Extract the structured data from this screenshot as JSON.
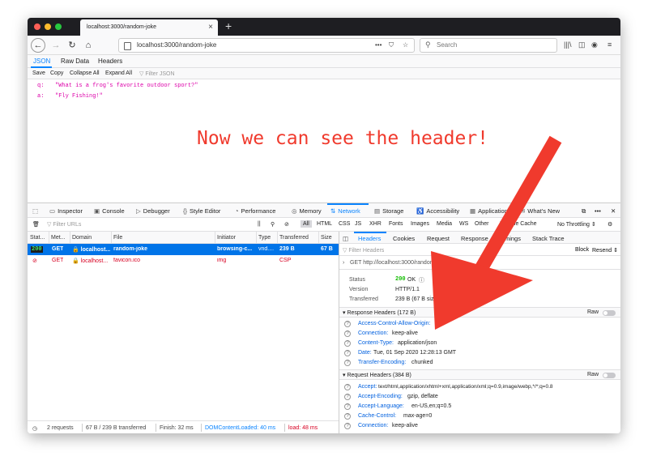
{
  "browser": {
    "tab_title": "localhost:3000/random-joke",
    "url": "localhost:3000/random-joke",
    "url_dots": "•••",
    "search_placeholder": "Search"
  },
  "json_viewer": {
    "tabs": [
      "JSON",
      "Raw Data",
      "Headers"
    ],
    "toolbar": [
      "Save",
      "Copy",
      "Collapse All",
      "Expand All"
    ],
    "filter_placeholder": "Filter JSON",
    "rows": [
      {
        "key": "q:",
        "value": "\"What is a frog's favorite outdoor sport?\""
      },
      {
        "key": "a:",
        "value": "\"Fly Fishing!\""
      }
    ]
  },
  "annotation": "Now we can see the header!",
  "devtools": {
    "tabs": [
      "Inspector",
      "Console",
      "Debugger",
      "Style Editor",
      "Performance",
      "Memory",
      "Network",
      "Storage",
      "Accessibility",
      "Application",
      "What's New"
    ],
    "filter_urls_placeholder": "Filter URLs",
    "type_filters": [
      "All",
      "HTML",
      "CSS",
      "JS",
      "XHR",
      "Fonts",
      "Images",
      "Media",
      "WS",
      "Other"
    ],
    "disable_cache": "Disable Cache",
    "throttling": "No Throttling",
    "columns": [
      "Stat...",
      "Met...",
      "Domain",
      "File",
      "Initiator",
      "Type",
      "Transferred",
      "Size"
    ],
    "requests": [
      {
        "status": "200",
        "method": "GET",
        "domain": "localhost...",
        "file": "random-joke",
        "initiator": "browsing-c...",
        "type": "vnd....",
        "transferred": "239 B",
        "size": "67 B"
      },
      {
        "status": "",
        "method": "GET",
        "domain": "localhost...",
        "file": "favicon.ico",
        "initiator": "img",
        "type": "",
        "transferred": "CSP",
        "size": ""
      }
    ],
    "status_bar": {
      "requests": "2 requests",
      "transferred": "67 B / 239 B transferred",
      "finish": "Finish: 32 ms",
      "dom": "DOMContentLoaded: 40 ms",
      "load": "load: 48 ms"
    },
    "detail_tabs": [
      "Headers",
      "Cookies",
      "Request",
      "Response",
      "Timings",
      "Stack Trace"
    ],
    "filter_headers_placeholder": "Filter Headers",
    "block": "Block",
    "resend": "Resend",
    "get_url": "GET  http://localhost:3000/random-joke",
    "summary": [
      {
        "label": "Status",
        "value": "200",
        "extra": "OK"
      },
      {
        "label": "Version",
        "value": "HTTP/1.1"
      },
      {
        "label": "Transferred",
        "value": "239 B (67 B size)"
      }
    ],
    "response_headers_title": "Response Headers (172 B)",
    "response_headers": [
      {
        "name": "Access-Control-Allow-Origin:",
        "value": "*"
      },
      {
        "name": "Connection:",
        "value": "keep-alive"
      },
      {
        "name": "Content-Type:",
        "value": "application/json"
      },
      {
        "name": "Date:",
        "value": "Tue, 01 Sep 2020 12:28:13 GMT"
      },
      {
        "name": "Transfer-Encoding:",
        "value": "chunked"
      }
    ],
    "request_headers_title": "Request Headers (384 B)",
    "request_headers": [
      {
        "name": "Accept:",
        "value": "text/html,application/xhtml+xml,application/xml;q=0.9,image/webp,*/*;q=0.8"
      },
      {
        "name": "Accept-Encoding:",
        "value": "gzip, deflate"
      },
      {
        "name": "Accept-Language:",
        "value": "en-US,en;q=0.5"
      },
      {
        "name": "Cache-Control:",
        "value": "max-age=0"
      },
      {
        "name": "Connection:",
        "value": "keep-alive"
      }
    ],
    "raw_label": "Raw"
  },
  "colors": {
    "accent": "#0a84ff",
    "annotation_red": "#f03a2d",
    "json_magenta": "#dd00a9",
    "status_green": "#3fe16a",
    "error_red": "#d70022"
  }
}
